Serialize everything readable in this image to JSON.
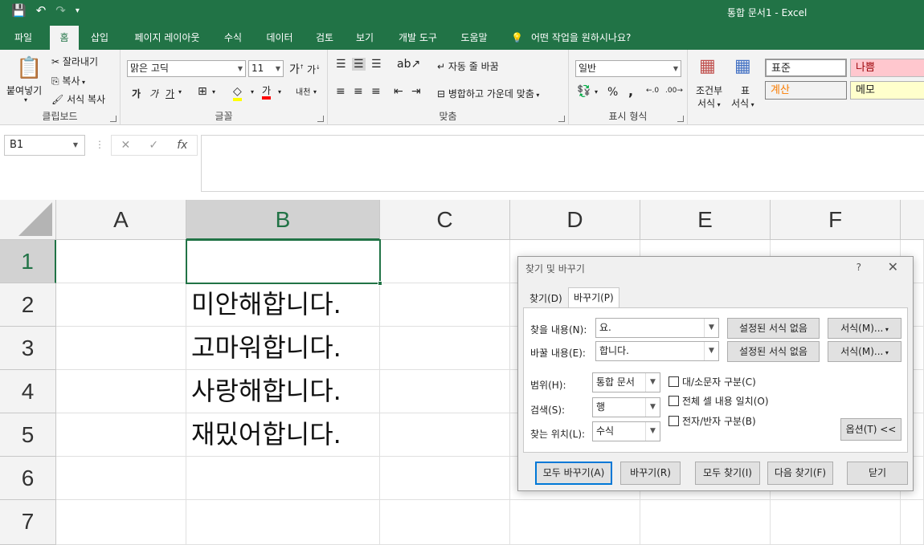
{
  "window": {
    "title": "통합 문서1  -  Excel",
    "qat_icons": [
      "save-icon",
      "undo-icon",
      "redo-icon",
      "customize-icon"
    ]
  },
  "ribbon_tabs": [
    {
      "label": "파일"
    },
    {
      "label": "홈"
    },
    {
      "label": "삽입"
    },
    {
      "label": "페이지 레이아웃"
    },
    {
      "label": "수식"
    },
    {
      "label": "데이터"
    },
    {
      "label": "검토"
    },
    {
      "label": "보기"
    },
    {
      "label": "개발 도구"
    },
    {
      "label": "도움말"
    }
  ],
  "active_tab": "홈",
  "tell_me": "어떤 작업을 원하시나요?",
  "clipboard": {
    "paste": "붙여넣기",
    "cut": "잘라내기",
    "copy": "복사",
    "format_painter": "서식 복사",
    "label": "클립보드"
  },
  "font": {
    "name": "맑은 고딕",
    "size": "11",
    "grow": "가",
    "shrink": "가",
    "bold": "가",
    "italic": "가",
    "underline": "가",
    "font_color_glyph": "가",
    "phonetic": "내천",
    "label": "글꼴"
  },
  "alignment": {
    "wrap_text": "자동 줄 바꿈",
    "merge_center": "병합하고 가운데 맞춤",
    "label": "맞춤"
  },
  "number": {
    "format": "일반",
    "percent": "%",
    "comma": ",",
    "label": "표시 형식"
  },
  "styles": {
    "conditional_line1": "조건부",
    "conditional_line2": "서식",
    "table_line1": "표",
    "table_line2": "서식",
    "normal": "표준",
    "bad": "나쁨",
    "calculation": "계산",
    "note": "메모"
  },
  "formula_bar": {
    "name_box": "B1",
    "cancel": "✕",
    "enter": "✓",
    "fx": "fx",
    "value": ""
  },
  "sheet": {
    "columns": [
      "A",
      "B",
      "C",
      "D",
      "E",
      "F"
    ],
    "rows": [
      "1",
      "2",
      "3",
      "4",
      "5",
      "6",
      "7"
    ],
    "selected_col": "B",
    "selected_row": "1",
    "cells": {
      "B2": "미안해합니다.",
      "B3": "고마워합니다.",
      "B4": "사랑해합니다.",
      "B5": "재밌어합니다."
    }
  },
  "dialog": {
    "title": "찾기 및 바꾸기",
    "help": "?",
    "close": "✕",
    "tabs": [
      "찾기(D)",
      "바꾸기(P)"
    ],
    "active_tab": "바꾸기(P)",
    "find_label": "찾을 내용(N):",
    "find_value": "요.",
    "replace_label": "바꿀 내용(E):",
    "replace_value": "합니다.",
    "no_format_1": "설정된 서식 없음",
    "no_format_2": "설정된 서식 없음",
    "format_1": "서식(M)...",
    "format_2": "서식(M)...",
    "within_label": "범위(H):",
    "within_value": "통합 문서",
    "search_label": "검색(S):",
    "search_value": "행",
    "lookin_label": "찾는 위치(L):",
    "lookin_value": "수식",
    "match_case": "대/소문자 구분(C)",
    "match_entire": "전체 셀 내용 일치(O)",
    "match_width": "전자/반자 구분(B)",
    "options_button": "옵션(T) <<",
    "replace_all": "모두 바꾸기(A)",
    "replace": "바꾸기(R)",
    "find_all": "모두 찾기(I)",
    "find_next": "다음 찾기(F)",
    "close_button": "닫기"
  }
}
